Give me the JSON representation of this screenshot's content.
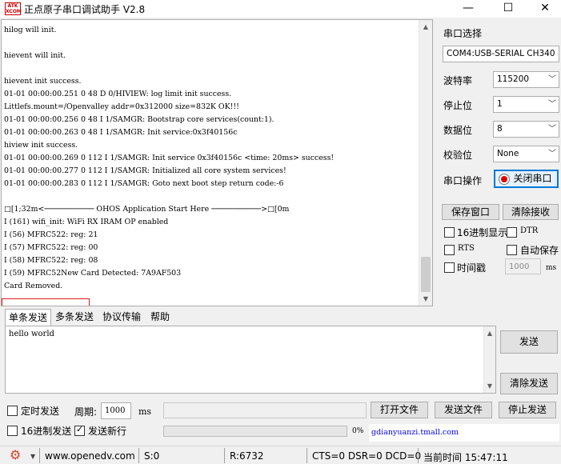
{
  "window": {
    "logo_text": "ATK XCOM",
    "title": "正点原子串口调试助手 V2.8",
    "minimize": "—",
    "maximize": "☐",
    "close": "✕"
  },
  "receive": {
    "lines": [
      "hilog will init.",
      "",
      "hievent will init.",
      "",
      "hievent init success.",
      "01-01 00:00:00.251 0 48 D 0/HIVIEW: log limit init success.",
      "Littlefs.mount=/Openvalley addr=0x312000 size=832K OK!!!",
      "01-01 00:00:00.256 0 48 I 1/SAMGR: Bootstrap core services(count:1).",
      "01-01 00:00:00.263 0 48 I 1/SAMGR: Init service:0x3f40156c",
      "hiview init success.",
      "01-01 00:00:00.269 0 112 I 1/SAMGR: Init service 0x3f40156c <time: 20ms> success!",
      "01-01 00:00:00.277 0 112 I 1/SAMGR: Initialized all core system services!",
      "01-01 00:00:00.283 0 112 I 1/SAMGR: Goto next boot step return code:-6",
      "",
      "□[1;32m<─────────── OHOS Application Start Here ───────────>□[0m",
      "I (161) wifi_init: WiFi RX IRAM OP enabled",
      "I (56) MFRC522: reg: 21",
      "I (57) MFRC522: reg: 00",
      "I (58) MFRC522: reg: 08",
      "I (59) MFRC52New Card Detected: 7A9AF503",
      "Card Removed."
    ]
  },
  "serial": {
    "section_label": "串口选择",
    "port_value": "COM4:USB-SERIAL CH340",
    "baud_label": "波特率",
    "baud_value": "115200",
    "stop_label": "停止位",
    "stop_value": "1",
    "data_label": "数据位",
    "data_value": "8",
    "parity_label": "校验位",
    "parity_value": "None",
    "op_label": "串口操作",
    "op_button": "关闭串口",
    "save_window": "保存窗口",
    "clear_receive": "清除接收",
    "hex_display": "16进制显示",
    "dtr": "DTR",
    "rts": "RTS",
    "auto_save": "自动保存",
    "timestamp": "时间戳",
    "timestamp_value": "1000",
    "timestamp_unit": "ms"
  },
  "tabs": [
    "单条发送",
    "多条发送",
    "协议传输",
    "帮助"
  ],
  "send": {
    "text": "hello world",
    "send_button": "发送",
    "clear_send": "清除发送",
    "timed_send": "定时发送",
    "period_label": "周期:",
    "period_value": "1000",
    "period_unit": "ms",
    "open_file": "打开文件",
    "send_file": "发送文件",
    "stop_send": "停止发送",
    "hex_send": "16进制发送",
    "send_newline": "发送新行",
    "progress": "0%",
    "link": "gdianyuanzi.tmall.com"
  },
  "status": {
    "website": "www.openedv.com",
    "sent": "S:0",
    "received": "R:6732",
    "signals": "CTS=0 DSR=0 DCD=0",
    "time": "当前时间 15:47:11"
  },
  "colors": {
    "accent": "#0078d7",
    "highlight_border": "#e01c1c",
    "gear": "#d9412b"
  }
}
